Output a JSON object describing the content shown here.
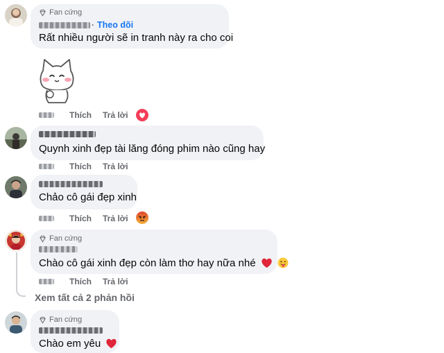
{
  "comments": [
    {
      "badge": "Fan cứng",
      "follow": "Theo dõi",
      "text": "Rất nhiều người sẽ in tranh này ra cho coi",
      "actions": {
        "like": "Thích",
        "reply": "Trả lời"
      },
      "reaction": "love-reaction"
    },
    {
      "text": "Quynh xinh đẹp tài lăng đóng phim nào cũng hay",
      "actions": {
        "like": "Thích",
        "reply": "Trả lời"
      }
    },
    {
      "text": "Chảo cô gái đẹp xinh",
      "actions": {
        "like": "Thích",
        "reply": "Trả lời"
      },
      "reaction": "angry-reaction"
    },
    {
      "badge": "Fan cứng",
      "text": "Chào cô gái xinh đẹp còn làm thơ hay nữa nhé",
      "actions": {
        "like": "Thích",
        "reply": "Trả lời"
      },
      "emojis": [
        "red-heart",
        "tongue-wink"
      ]
    },
    {
      "badge": "Fan cứng",
      "text": "Chào em yêu",
      "emojis": [
        "red-heart"
      ]
    }
  ],
  "see_more_replies": "Xem tất cả 2 phản hồi",
  "colors": {
    "bubble": "#f0f2f5",
    "link": "#1877f2",
    "muted": "#65676b",
    "thread": "#ced0d4",
    "love": "#f33e58",
    "angry": "#e9710f"
  }
}
